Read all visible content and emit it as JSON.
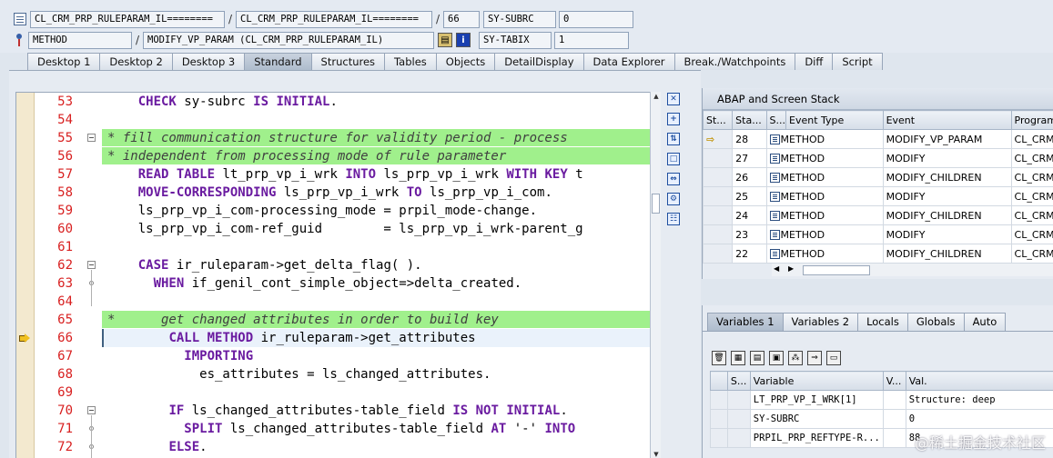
{
  "header": {
    "row1": {
      "include": "CL_CRM_PRP_RULEPARAM_IL========",
      "program": "CL_CRM_PRP_RULEPARAM_IL========",
      "line": "66",
      "sysvar_name": "SY-SUBRC",
      "sysvar_value": "0"
    },
    "row2": {
      "event_type": "METHOD",
      "event": "MODIFY_VP_PARAM (CL_CRM_PRP_RULEPARAM_IL)",
      "sysvar_name": "SY-TABIX",
      "sysvar_value": "1"
    },
    "separator": "/",
    "info_button": "i"
  },
  "tabs": [
    "Desktop 1",
    "Desktop 2",
    "Desktop 3",
    "Standard",
    "Structures",
    "Tables",
    "Objects",
    "DetailDisplay",
    "Data Explorer",
    "Break./Watchpoints",
    "Diff",
    "Script"
  ],
  "active_tab": "Standard",
  "code_lines": [
    {
      "n": "53",
      "parts": [
        {
          "t": "    "
        },
        {
          "t": "CHECK",
          "k": 1
        },
        {
          "t": " sy-subrc "
        },
        {
          "t": "IS",
          "k": 1
        },
        {
          "t": " "
        },
        {
          "t": "INITIAL",
          "k": 1
        },
        {
          "t": "."
        }
      ]
    },
    {
      "n": "54",
      "parts": []
    },
    {
      "n": "55",
      "comment": true,
      "fold": true,
      "parts": [
        {
          "t": "* fill communication structure for validity period - process"
        }
      ]
    },
    {
      "n": "56",
      "comment": true,
      "parts": [
        {
          "t": "* independent from processing mode of rule parameter"
        }
      ]
    },
    {
      "n": "57",
      "parts": [
        {
          "t": "    "
        },
        {
          "t": "READ TABLE",
          "k": 1
        },
        {
          "t": " lt_prp_vp_i_wrk "
        },
        {
          "t": "INTO",
          "k": 1
        },
        {
          "t": " ls_prp_vp_i_wrk "
        },
        {
          "t": "WITH KEY",
          "k": 1
        },
        {
          "t": " t"
        }
      ]
    },
    {
      "n": "58",
      "parts": [
        {
          "t": "    "
        },
        {
          "t": "MOVE-CORRESPONDING",
          "k": 1
        },
        {
          "t": " ls_prp_vp_i_wrk "
        },
        {
          "t": "TO",
          "k": 1
        },
        {
          "t": " ls_prp_vp_i_com."
        }
      ]
    },
    {
      "n": "59",
      "parts": [
        {
          "t": "    ls_prp_vp_i_com-processing_mode = prpil_mode-change."
        }
      ]
    },
    {
      "n": "60",
      "parts": [
        {
          "t": "    ls_prp_vp_i_com-ref_guid        = ls_prp_vp_i_wrk-parent_g"
        }
      ]
    },
    {
      "n": "61",
      "parts": []
    },
    {
      "n": "62",
      "fold": true,
      "parts": [
        {
          "t": "    "
        },
        {
          "t": "CASE",
          "k": 1
        },
        {
          "t": " ir_ruleparam->get_delta_flag( )."
        }
      ]
    },
    {
      "n": "63",
      "dot": true,
      "parts": [
        {
          "t": "      "
        },
        {
          "t": "WHEN",
          "k": 1
        },
        {
          "t": " if_genil_cont_simple_object=>delta_created."
        }
      ]
    },
    {
      "n": "64",
      "parts": []
    },
    {
      "n": "65",
      "comment": true,
      "parts": [
        {
          "t": "*      get changed attributes in order to build key"
        }
      ]
    },
    {
      "n": "66",
      "current": true,
      "parts": [
        {
          "t": "        "
        },
        {
          "t": "CALL METHOD",
          "k": 1
        },
        {
          "t": " ir_ruleparam->get_attributes"
        }
      ]
    },
    {
      "n": "67",
      "parts": [
        {
          "t": "          "
        },
        {
          "t": "IMPORTING",
          "k": 1
        }
      ]
    },
    {
      "n": "68",
      "parts": [
        {
          "t": "            es_attributes = ls_changed_attributes."
        }
      ]
    },
    {
      "n": "69",
      "parts": []
    },
    {
      "n": "70",
      "fold": true,
      "parts": [
        {
          "t": "        "
        },
        {
          "t": "IF",
          "k": 1
        },
        {
          "t": " ls_changed_attributes-table_field "
        },
        {
          "t": "IS",
          "k": 1
        },
        {
          "t": " "
        },
        {
          "t": "NOT",
          "k": 1
        },
        {
          "t": " "
        },
        {
          "t": "INITIAL",
          "k": 1
        },
        {
          "t": "."
        }
      ]
    },
    {
      "n": "71",
      "dot": true,
      "parts": [
        {
          "t": "          "
        },
        {
          "t": "SPLIT",
          "k": 1
        },
        {
          "t": " ls_changed_attributes-table_field "
        },
        {
          "t": "AT",
          "k": 1
        },
        {
          "t": " '-' "
        },
        {
          "t": "INTO",
          "k": 1
        }
      ]
    },
    {
      "n": "72",
      "dot": true,
      "parts": [
        {
          "t": "        "
        },
        {
          "t": "ELSE",
          "k": 1
        },
        {
          "t": "."
        }
      ]
    }
  ],
  "stack": {
    "title": "ABAP and Screen Stack",
    "columns": [
      "St...",
      "Sta...",
      "S...",
      "Event Type",
      "Event",
      "Program"
    ],
    "rows": [
      {
        "level": "28",
        "type": "METHOD",
        "event": "MODIFY_VP_PARAM",
        "program": "CL_CRM",
        "current": true
      },
      {
        "level": "27",
        "type": "METHOD",
        "event": "MODIFY",
        "program": "CL_CRM"
      },
      {
        "level": "26",
        "type": "METHOD",
        "event": "MODIFY_CHILDREN",
        "program": "CL_CRM"
      },
      {
        "level": "25",
        "type": "METHOD",
        "event": "MODIFY",
        "program": "CL_CRM"
      },
      {
        "level": "24",
        "type": "METHOD",
        "event": "MODIFY_CHILDREN",
        "program": "CL_CRM"
      },
      {
        "level": "23",
        "type": "METHOD",
        "event": "MODIFY",
        "program": "CL_CRM"
      },
      {
        "level": "22",
        "type": "METHOD",
        "event": "MODIFY_CHILDREN",
        "program": "CL_CRM"
      }
    ]
  },
  "vars": {
    "tabs": [
      "Variables 1",
      "Variables 2",
      "Locals",
      "Globals",
      "Auto"
    ],
    "active_tab": "Variables 1",
    "columns": [
      "S...",
      "Variable",
      "V...",
      "Val."
    ],
    "rows": [
      {
        "name": "LT_PRP_VP_I_WRK[1]",
        "value": "Structure: deep"
      },
      {
        "name": "SY-SUBRC",
        "value": "0"
      },
      {
        "name": "PRPIL_PRP_REFTYPE-R...",
        "value": "88"
      }
    ]
  },
  "watermark": "@稀土掘金技术社区"
}
